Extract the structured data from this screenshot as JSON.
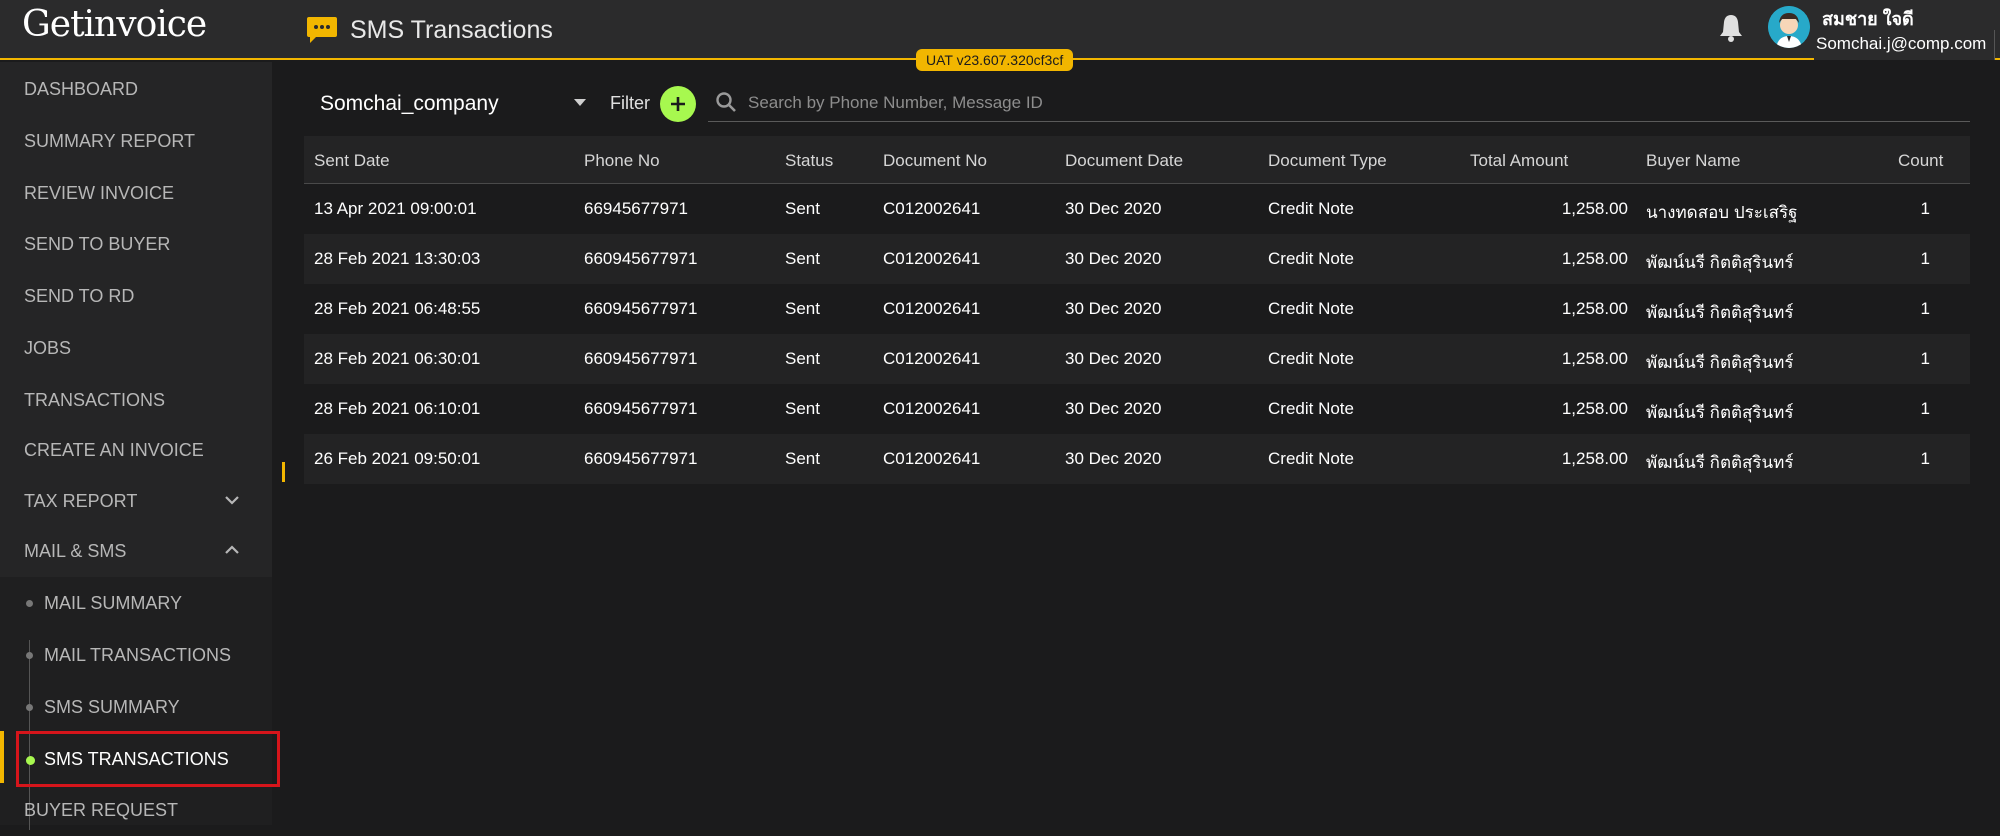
{
  "header": {
    "logo": "Getinvoice",
    "page_title": "SMS Transactions",
    "env_badge": "UAT v23.607.320cf3cf",
    "user_name": "สมชาย ใจดี",
    "user_email": "Somchai.j@comp.com"
  },
  "sidebar": {
    "items": [
      {
        "label": "DASHBOARD"
      },
      {
        "label": "SUMMARY REPORT"
      },
      {
        "label": "REVIEW INVOICE"
      },
      {
        "label": "SEND TO BUYER"
      },
      {
        "label": "SEND TO RD"
      },
      {
        "label": "JOBS"
      },
      {
        "label": "TRANSACTIONS"
      },
      {
        "label": "CREATE AN INVOICE"
      },
      {
        "label": "TAX REPORT"
      },
      {
        "label": "MAIL & SMS"
      },
      {
        "label": "MAIL SUMMARY"
      },
      {
        "label": "MAIL TRANSACTIONS"
      },
      {
        "label": "SMS SUMMARY"
      },
      {
        "label": "SMS TRANSACTIONS"
      },
      {
        "label": "BUYER REQUEST"
      }
    ],
    "active_item": "SMS TRANSACTIONS"
  },
  "filters": {
    "company": "Somchai_company",
    "filter_label": "Filter",
    "search_placeholder": "Search by Phone Number, Message ID"
  },
  "table": {
    "columns": [
      "Sent Date",
      "Phone No",
      "Status",
      "Document No",
      "Document Date",
      "Document Type",
      "Total Amount",
      "Buyer Name",
      "Count"
    ],
    "rows": [
      [
        "13 Apr 2021 09:00:01",
        "66945677971",
        "Sent",
        "C012002641",
        "30 Dec 2020",
        "Credit Note",
        "1,258.00",
        "นางทดสอบ ประเสริฐ",
        "1"
      ],
      [
        "28 Feb 2021 13:30:03",
        "660945677971",
        "Sent",
        "C012002641",
        "30 Dec 2020",
        "Credit Note",
        "1,258.00",
        "พัฒน์นรี กิตติสุรินทร์",
        "1"
      ],
      [
        "28 Feb 2021 06:48:55",
        "660945677971",
        "Sent",
        "C012002641",
        "30 Dec 2020",
        "Credit Note",
        "1,258.00",
        "พัฒน์นรี กิตติสุรินทร์",
        "1"
      ],
      [
        "28 Feb 2021 06:30:01",
        "660945677971",
        "Sent",
        "C012002641",
        "30 Dec 2020",
        "Credit Note",
        "1,258.00",
        "พัฒน์นรี กิตติสุรินทร์",
        "1"
      ],
      [
        "28 Feb 2021 06:10:01",
        "660945677971",
        "Sent",
        "C012002641",
        "30 Dec 2020",
        "Credit Note",
        "1,258.00",
        "พัฒน์นรี กิตติสุรินทร์",
        "1"
      ],
      [
        "26 Feb 2021 09:50:01",
        "660945677971",
        "Sent",
        "C012002641",
        "30 Dec 2020",
        "Credit Note",
        "1,258.00",
        "พัฒน์นรี กิตติสุรินทร์",
        "1"
      ]
    ]
  },
  "colors": {
    "accent": "#f2b600",
    "add_button": "#a7f84f",
    "highlight": "#d6151b",
    "avatar": "#27a9c9"
  },
  "icons": {
    "page": "message-icon",
    "notifications": "bell-icon",
    "search": "search-icon",
    "add": "plus-icon",
    "expand": "chevron-down-icon",
    "collapse": "chevron-up-icon"
  }
}
